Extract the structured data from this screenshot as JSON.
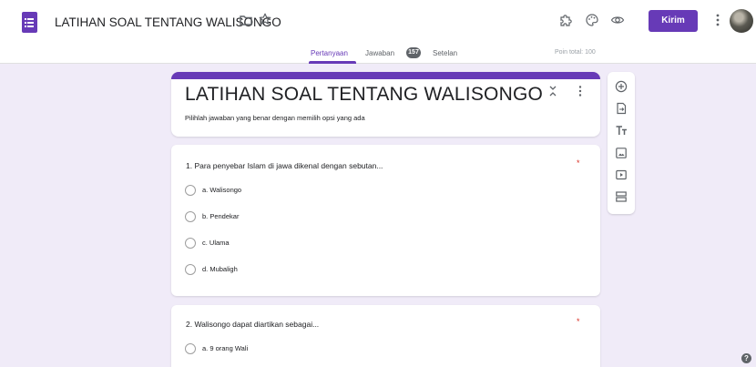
{
  "header": {
    "doc_title": "LATIHAN SOAL TENTANG WALISONGO",
    "send_label": "Kirim",
    "accent_color": "#673ab7"
  },
  "tabs": {
    "questions": "Pertanyaan",
    "responses": "Jawaban",
    "responses_count": "157",
    "settings": "Setelan",
    "points": "Poin total: 100"
  },
  "form": {
    "title": "LATIHAN SOAL TENTANG WALISONGO",
    "description": "Pilihlah jawaban yang benar dengan memilih opsi yang ada"
  },
  "questions": [
    {
      "text": "1.  Para penyebar Islam di jawa dikenal dengan sebutan...",
      "required": "*",
      "options": [
        "a. Walisongo",
        "b. Pendekar",
        "c. Ulama",
        "d. Mubaligh"
      ]
    },
    {
      "text": "2.  Walisongo dapat diartikan sebagai...",
      "required": "*",
      "options": [
        "a. 9 orang Wali"
      ]
    }
  ],
  "icons": {
    "app": "google-forms-icon",
    "folder": "folder-icon",
    "star": "star-icon",
    "addons": "puzzle-icon",
    "palette": "palette-icon",
    "preview": "eye-icon",
    "more": "more-vert-icon",
    "toolbar": [
      "add-question-icon",
      "import-questions-icon",
      "add-title-icon",
      "add-image-icon",
      "add-video-icon",
      "add-section-icon"
    ],
    "help": "help-icon"
  },
  "help_label": "?"
}
